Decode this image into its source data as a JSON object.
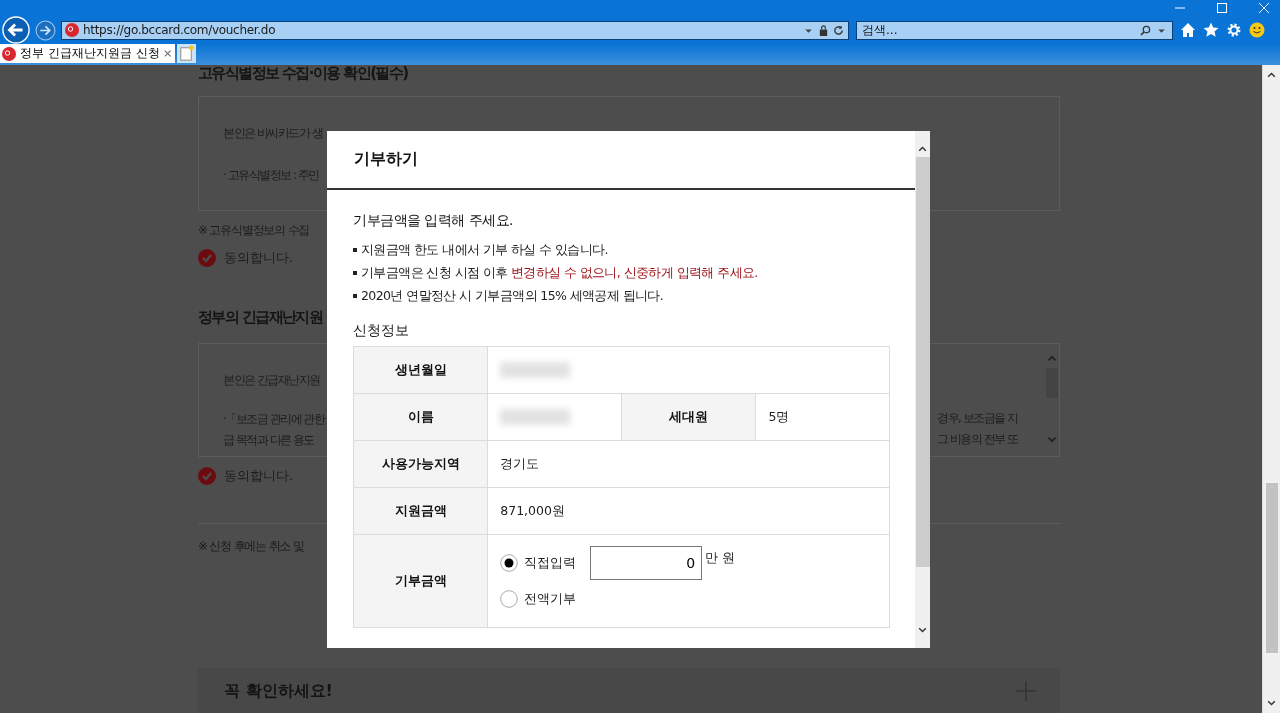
{
  "browser": {
    "url": "https://go.bccard.com/voucher.do",
    "search": {
      "placeholder": "검색..."
    },
    "tabs": [
      {
        "title": "정부 긴급재난지원금 신청",
        "selected": true
      }
    ]
  },
  "page": {
    "sections": [
      {
        "heading": "고유식별정보 수집·이용 확인(필수)",
        "box_lines": [
          "본인은 비씨카드가 생",
          "· 고유식별정보 : 주민"
        ],
        "scrollable": false,
        "note": "※ 고유식별정보의 수집",
        "agree": {
          "label": "동의합니다.",
          "checked": true
        }
      },
      {
        "heading": "정부의 긴급재난지원",
        "box_lines": [
          "본인은 긴급재난지원",
          "·「보조금 관리에 관한",
          "급 목적과 다른 용도"
        ],
        "box_right_lines": [
          "경우, 보조금을 지",
          "그 비용의 전부 또"
        ],
        "scrollable": true,
        "agree": {
          "label": "동의합니다.",
          "checked": true
        }
      }
    ],
    "footer_note": "※ 신청 후에는 취소 및",
    "notice_card": {
      "title": "꼭 확인하세요!",
      "expanded": false
    }
  },
  "modal": {
    "title": "기부하기",
    "intro": "기부금액을 입력해 주세요.",
    "bullets": [
      {
        "text": "지원금액 한도 내에서 기부 하실 수 있습니다."
      },
      {
        "text": "기부금액은 신청 시점 이후 ",
        "emphasis": "변경하실 수 없으니, 신중하게 입력해 주세요."
      },
      {
        "text": "2020년 연말정산 시 기부금액의 15% 세액공제 됩니다."
      }
    ],
    "info_title": "신청정보",
    "rows": [
      {
        "cells": [
          {
            "label": "생년월일",
            "kind": "redacted"
          }
        ]
      },
      {
        "cells": [
          {
            "label": "이름",
            "kind": "redacted"
          },
          {
            "label": "세대원",
            "kind": "text",
            "value": "5명"
          }
        ]
      },
      {
        "cells": [
          {
            "label": "사용가능지역",
            "kind": "text",
            "value": "경기도"
          }
        ]
      },
      {
        "cells": [
          {
            "label": "지원금액",
            "kind": "text",
            "value": "871,000원"
          }
        ]
      },
      {
        "cells": [
          {
            "label": "기부금액",
            "kind": "donation"
          }
        ]
      }
    ],
    "donation": {
      "options": [
        {
          "label": "직접입력",
          "selected": true
        },
        {
          "label": "전액기부",
          "selected": false
        }
      ],
      "amount": "0",
      "unit": "만 원"
    }
  }
}
